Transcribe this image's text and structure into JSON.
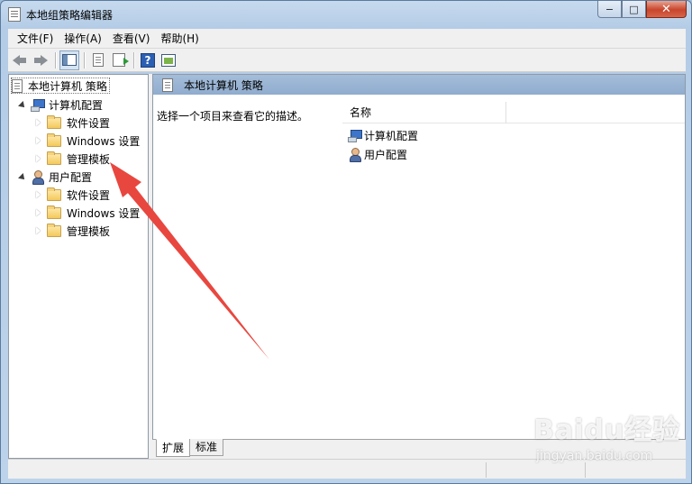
{
  "window": {
    "title": "本地组策略编辑器",
    "controls": {
      "minimize": "−",
      "maximize": "□",
      "close": "✕"
    }
  },
  "menubar": {
    "items": [
      {
        "label": "文件(F)"
      },
      {
        "label": "操作(A)"
      },
      {
        "label": "查看(V)"
      },
      {
        "label": "帮助(H)"
      }
    ]
  },
  "toolbar": {
    "icons": [
      "back-arrow-icon",
      "forward-arrow-icon",
      "show-hide-tree-icon",
      "properties-icon",
      "export-list-icon",
      "help-icon",
      "show-pane-icon"
    ],
    "help_glyph": "?"
  },
  "tree": {
    "root": "本地计算机 策略",
    "computer_config": {
      "label": "计算机配置",
      "children": [
        "软件设置",
        "Windows 设置",
        "管理模板"
      ]
    },
    "user_config": {
      "label": "用户配置",
      "children": [
        "软件设置",
        "Windows 设置",
        "管理模板"
      ]
    }
  },
  "detail": {
    "header_title": "本地计算机 策略",
    "description": "选择一个项目来查看它的描述。",
    "column_name": "名称",
    "items": [
      "计算机配置",
      "用户配置"
    ]
  },
  "tabs": [
    {
      "label": "扩展",
      "active": true
    },
    {
      "label": "标准",
      "active": false
    }
  ],
  "watermark": {
    "main": "Baidu经验",
    "sub": "jingyan.baidu.com"
  },
  "colors": {
    "annotation_arrow": "#e8473f",
    "detail_header": "#a4bdd9",
    "window_frame": "#b4cce6"
  }
}
